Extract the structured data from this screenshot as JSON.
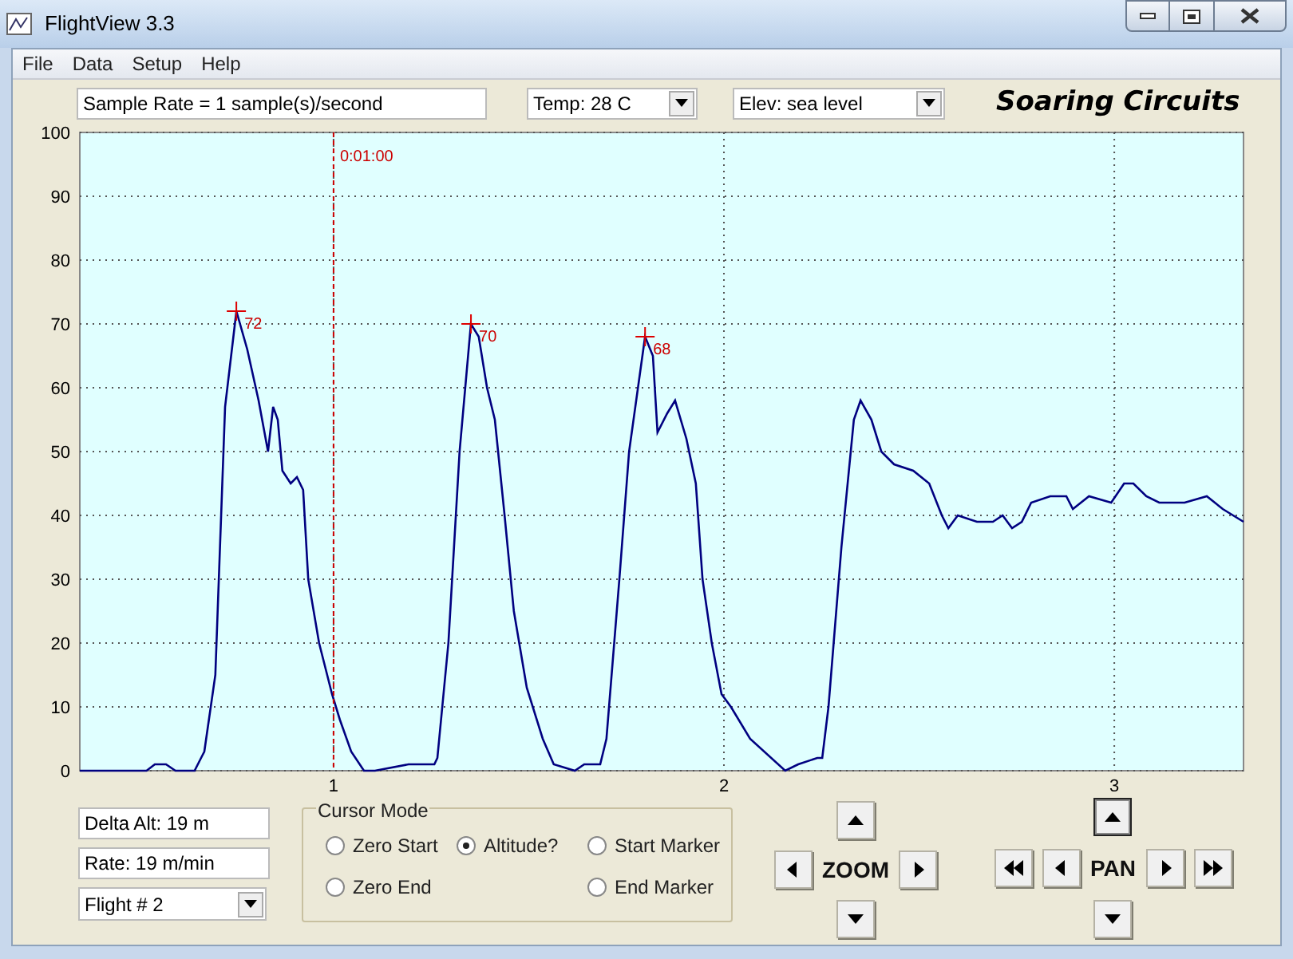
{
  "window": {
    "title": "FlightView 3.3"
  },
  "menu": [
    {
      "label": "File"
    },
    {
      "label": "Data"
    },
    {
      "label": "Setup"
    },
    {
      "label": "Help"
    }
  ],
  "toolbar": {
    "sample_rate": {
      "value": "Sample Rate =  1 sample(s)/second"
    },
    "temp": {
      "value": "Temp:  28 C"
    },
    "elev": {
      "value": "Elev: sea level"
    },
    "brand": "Soaring Circuits"
  },
  "chart": {
    "chart_data": {
      "type": "line",
      "xlim": [
        0.35,
        3.331
      ],
      "ylim": [
        0,
        100
      ],
      "xticks": [
        1,
        2,
        3
      ],
      "yticks": [
        0,
        10,
        20,
        30,
        40,
        50,
        60,
        70,
        80,
        90,
        100
      ],
      "x": [
        0.35,
        0.521,
        0.542,
        0.571,
        0.595,
        0.644,
        0.669,
        0.697,
        0.722,
        0.751,
        0.779,
        0.808,
        0.832,
        0.845,
        0.857,
        0.869,
        0.89,
        0.906,
        0.922,
        0.935,
        0.963,
        0.996,
        1.016,
        1.045,
        1.078,
        1.106,
        1.192,
        1.2,
        1.258,
        1.266,
        1.294,
        1.323,
        1.352,
        1.372,
        1.393,
        1.413,
        1.438,
        1.462,
        1.495,
        1.536,
        1.564,
        1.618,
        1.642,
        1.683,
        1.699,
        1.732,
        1.757,
        1.798,
        1.818,
        1.83,
        1.855,
        1.875,
        1.904,
        1.928,
        1.945,
        1.969,
        1.994,
        2.018,
        2.067,
        2.157,
        2.19,
        2.239,
        2.252,
        2.268,
        2.301,
        2.333,
        2.35,
        2.378,
        2.403,
        2.436,
        2.485,
        2.526,
        2.558,
        2.575,
        2.599,
        2.648,
        2.689,
        2.714,
        2.738,
        2.763,
        2.787,
        2.836,
        2.877,
        2.894,
        2.935,
        2.992,
        3.025,
        3.049,
        3.082,
        3.115,
        3.18,
        3.237,
        3.278,
        3.331
      ],
      "series": [
        {
          "color": "#000080",
          "values": [
            0,
            0,
            1,
            1,
            0,
            0,
            3,
            15,
            57,
            72,
            66,
            58,
            50,
            57,
            55,
            47,
            45,
            46,
            44,
            30,
            20,
            12,
            8,
            3,
            0,
            0,
            1,
            1,
            1,
            2,
            20,
            50,
            70,
            68,
            60,
            55,
            40,
            25,
            13,
            5,
            1,
            0,
            1,
            1,
            5,
            30,
            50,
            68,
            65,
            53,
            56,
            58,
            52,
            45,
            30,
            20,
            12,
            10,
            5,
            0,
            1,
            2,
            2,
            10,
            35,
            55,
            58,
            55,
            50,
            48,
            47,
            45,
            40,
            38,
            40,
            39,
            39,
            40,
            38,
            39,
            42,
            43,
            43,
            41,
            43,
            42,
            45,
            45,
            43,
            42,
            42,
            43,
            41,
            39
          ]
        }
      ],
      "grid": true,
      "ref_lines": [
        {
          "axis": "x",
          "value": 1,
          "label": "0:01:00",
          "color": "#cc0000"
        }
      ],
      "annotations": [
        {
          "x": 0.751,
          "y": 72,
          "text": "72"
        },
        {
          "x": 1.352,
          "y": 70,
          "text": "70"
        },
        {
          "x": 1.798,
          "y": 68,
          "text": "68"
        }
      ]
    }
  },
  "readouts": {
    "delta_alt": {
      "value": "Delta Alt: 19 m"
    },
    "rate": {
      "value": "Rate: 19 m/min"
    },
    "flight": {
      "value": "Flight # 2"
    }
  },
  "cursor_mode": {
    "title": "Cursor Mode",
    "options": [
      {
        "label": "Zero Start",
        "selected": false
      },
      {
        "label": "Altitude?",
        "selected": true
      },
      {
        "label": "Start Marker",
        "selected": false
      },
      {
        "label": "Zero End",
        "selected": false
      },
      {
        "label": "End Marker",
        "selected": false
      }
    ]
  },
  "zoom": {
    "label": "ZOOM"
  },
  "pan": {
    "label": "PAN"
  }
}
